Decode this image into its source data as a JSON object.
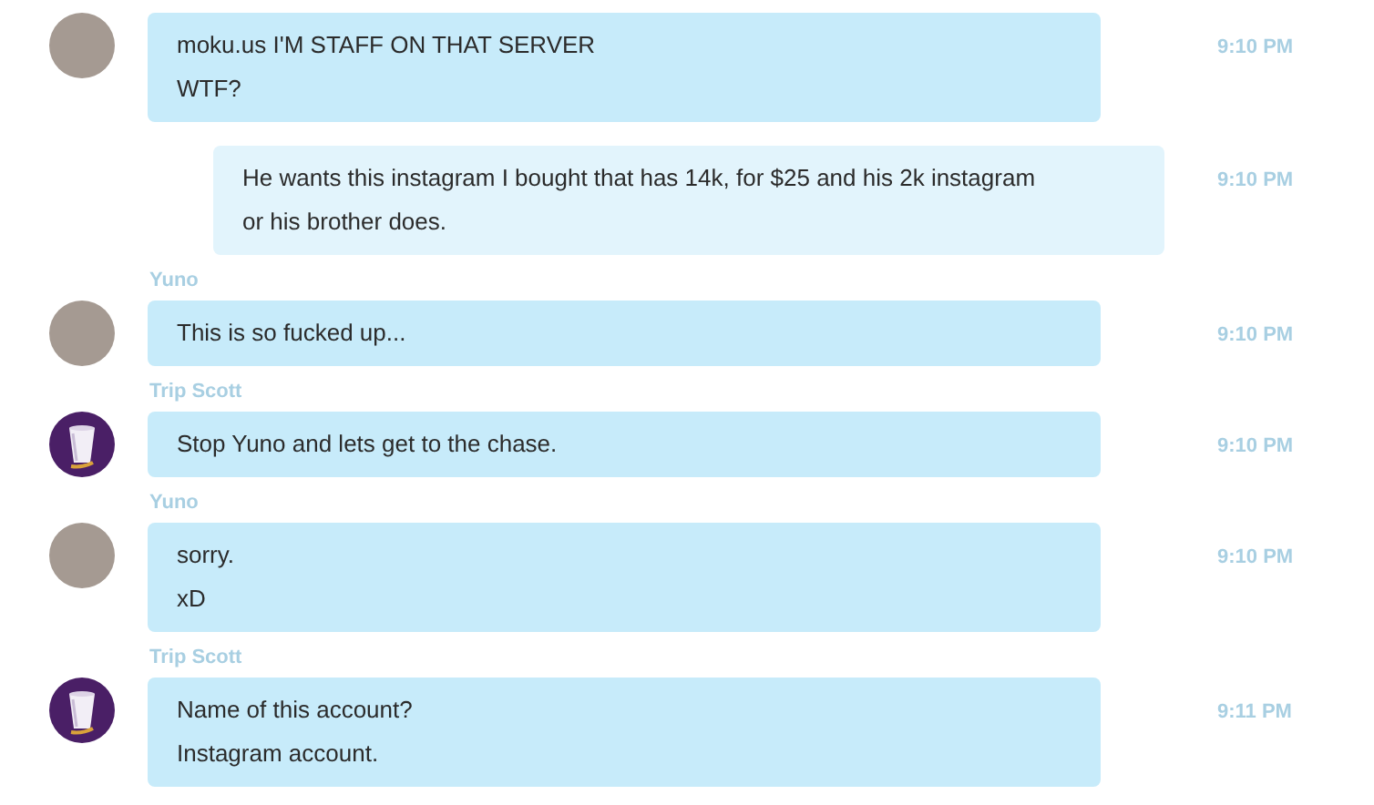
{
  "messages": [
    {
      "kind": "incoming",
      "avatar": {
        "kind": "photo"
      },
      "lines": [
        "moku.us I'M STAFF ON THAT SERVER",
        "WTF?"
      ],
      "time": "9:10 PM"
    },
    {
      "kind": "outgoing",
      "lines": [
        "He wants this instagram I bought that has 14k, for $25 and his 2k instagram",
        "or his brother does."
      ],
      "time": "9:10 PM"
    },
    {
      "kind": "incoming",
      "sender": "Yuno",
      "avatar": {
        "kind": "photo"
      },
      "lines": [
        "This is so fucked up..."
      ],
      "time": "9:10 PM"
    },
    {
      "kind": "incoming",
      "sender": "Trip Scott",
      "avatar": {
        "kind": "cup"
      },
      "lines": [
        "Stop Yuno and lets get to the chase."
      ],
      "time": "9:10 PM"
    },
    {
      "kind": "incoming",
      "sender": "Yuno",
      "avatar": {
        "kind": "photo"
      },
      "lines": [
        "sorry.",
        "xD"
      ],
      "time": "9:10 PM"
    },
    {
      "kind": "incoming",
      "sender": "Trip Scott",
      "avatar": {
        "kind": "cup"
      },
      "lines": [
        "Name of this account?",
        "Instagram account."
      ],
      "time": "9:11 PM"
    }
  ]
}
